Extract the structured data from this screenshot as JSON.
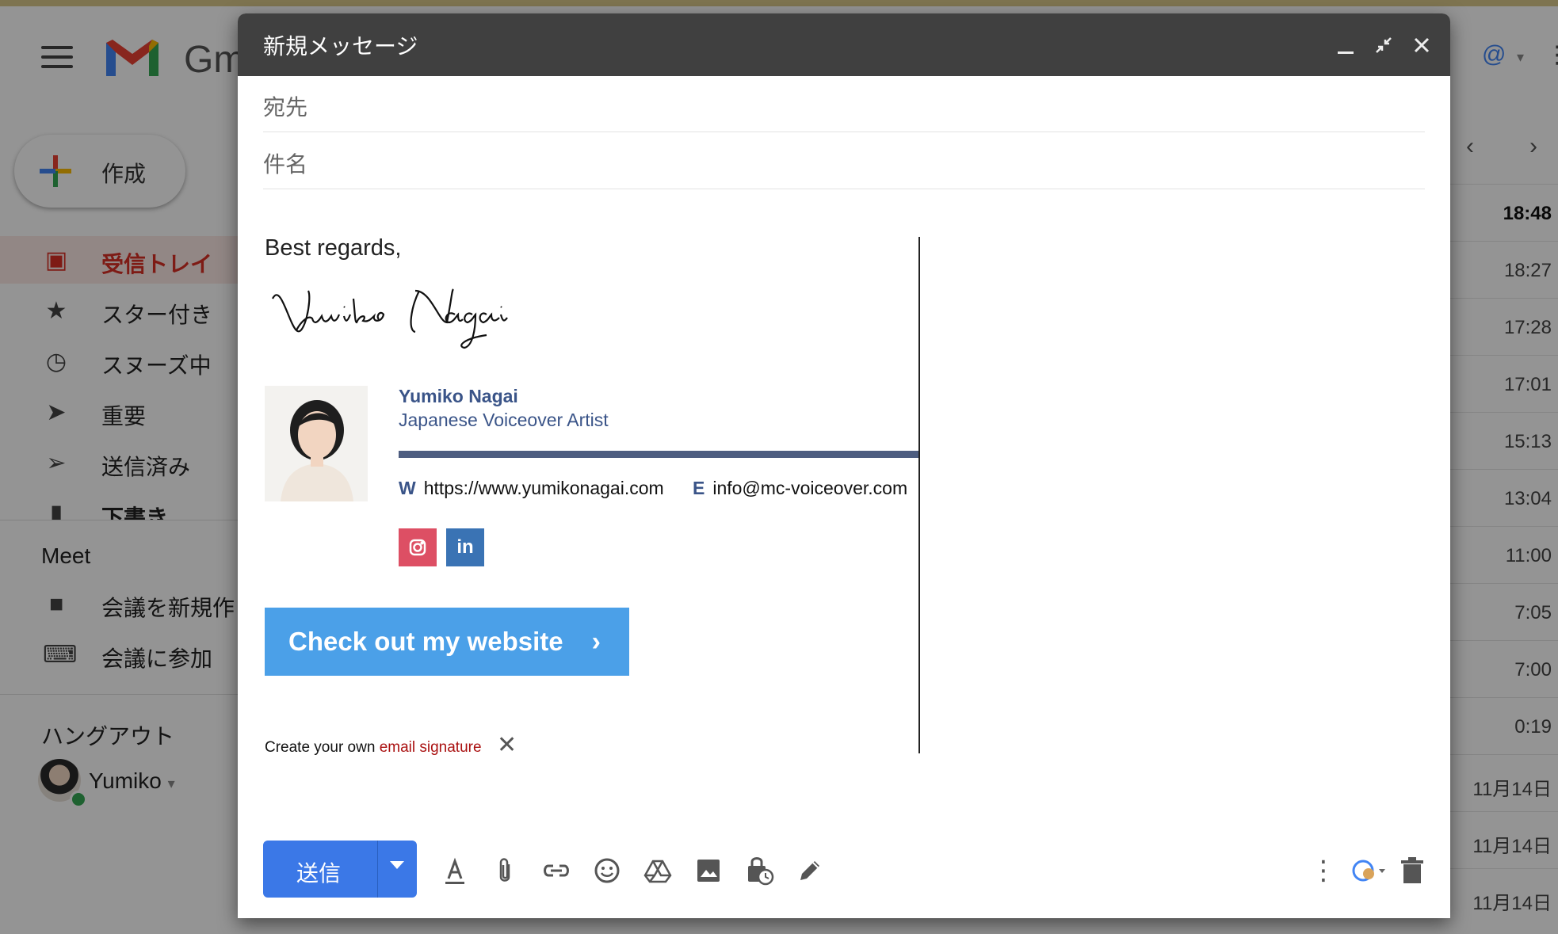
{
  "gmail": {
    "logo_text": "Gm",
    "compose_label": "作成",
    "nav": [
      {
        "label": "受信トレイ"
      },
      {
        "label": "スター付き"
      },
      {
        "label": "スヌーズ中"
      },
      {
        "label": "重要"
      },
      {
        "label": "送信済み"
      },
      {
        "label": "下書き"
      }
    ],
    "meet": {
      "heading": "Meet",
      "items": [
        {
          "label": "会議を新規作"
        },
        {
          "label": "会議に参加"
        }
      ]
    },
    "hangouts": {
      "heading": "ハングアウト",
      "user": "Yumiko"
    },
    "times": [
      "18:48",
      "18:27",
      "17:28",
      "17:01",
      "15:13",
      "13:04",
      "11:00",
      "7:05",
      "7:00",
      "0:19",
      "11月14日",
      "11月14日",
      "11月14日"
    ]
  },
  "compose": {
    "title": "新規メッセージ",
    "to_placeholder": "宛先",
    "subject_placeholder": "件名",
    "signature": {
      "greeting": "Best regards,",
      "script_name": "Yumiko Nagai",
      "name": "Yumiko Nagai",
      "role": "Japanese Voiceover Artist",
      "web_label": "W",
      "web": "https://www.yumikonagai.com",
      "email_label": "E",
      "email": "info@mc-voiceover.com",
      "social": [
        {
          "icon": "instagram-icon",
          "color": "#dd4f64"
        },
        {
          "icon": "linkedin-icon",
          "label": "in",
          "color": "#3a73b4"
        }
      ],
      "cta": "Check out my website",
      "cta_color": "#4ba0e8",
      "bar_color": "#4d5d80",
      "create_text": "Create your own ",
      "create_link": "email signature"
    },
    "send_label": "送信",
    "send_color": "#3b78e7"
  }
}
